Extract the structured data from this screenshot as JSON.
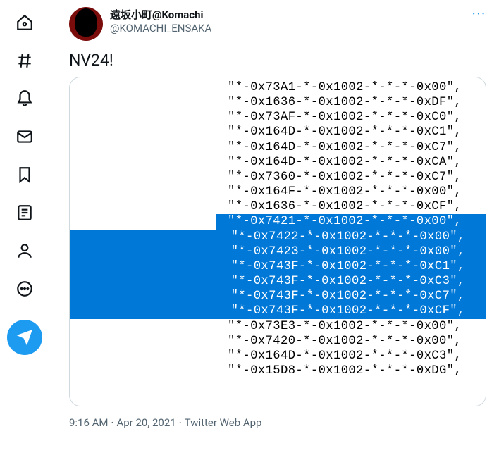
{
  "sidebar": {
    "items": [
      {
        "name": "home-icon"
      },
      {
        "name": "explore-icon"
      },
      {
        "name": "notifications-icon"
      },
      {
        "name": "messages-icon"
      },
      {
        "name": "bookmarks-icon"
      },
      {
        "name": "lists-icon"
      },
      {
        "name": "profile-icon"
      },
      {
        "name": "more-icon"
      }
    ]
  },
  "tweet": {
    "display_name": "遠坂小町@Komachi",
    "handle": "@KOMACHI_ENSAKA",
    "text": "NV24!",
    "more_label": "···",
    "timestamp": "9:16 AM",
    "date": "Apr 20, 2021",
    "source": "Twitter Web App"
  },
  "code": {
    "lines": [
      {
        "t": "\"*-0x73A1-*-0x1002-*-*-*-0x00\",",
        "hl": false
      },
      {
        "t": "\"*-0x1636-*-0x1002-*-*-*-0xDF\",",
        "hl": false
      },
      {
        "t": "\"*-0x73AF-*-0x1002-*-*-*-0xC0\",",
        "hl": false
      },
      {
        "t": "\"*-0x164D-*-0x1002-*-*-*-0xC1\",",
        "hl": false
      },
      {
        "t": "\"*-0x164D-*-0x1002-*-*-*-0xC7\",",
        "hl": false
      },
      {
        "t": "\"*-0x164D-*-0x1002-*-*-*-0xCA\",",
        "hl": false
      },
      {
        "t": "\"*-0x7360-*-0x1002-*-*-*-0xC7\",",
        "hl": false
      },
      {
        "t": "\"*-0x164F-*-0x1002-*-*-*-0x00\",",
        "hl": false
      },
      {
        "t": "\"*-0x1636-*-0x1002-*-*-*-0xCF\",",
        "hl": false
      },
      {
        "t": "\"*-0x7421-*-0x1002-*-*-*-0x00\",",
        "hl": true,
        "first": true
      },
      {
        "t": "            \"*-0x7422-*-0x1002-*-*-*-0x00\",",
        "hl": true
      },
      {
        "t": "            \"*-0x7423-*-0x1002-*-*-*-0x00\",",
        "hl": true
      },
      {
        "t": "            \"*-0x743F-*-0x1002-*-*-*-0xC1\",",
        "hl": true
      },
      {
        "t": "            \"*-0x743F-*-0x1002-*-*-*-0xC3\",",
        "hl": true
      },
      {
        "t": "            \"*-0x743F-*-0x1002-*-*-*-0xC7\",",
        "hl": true
      },
      {
        "t": "            \"*-0x743F-*-0x1002-*-*-*-0xCF\",",
        "hl": true
      },
      {
        "t": "\"*-0x73E3-*-0x1002-*-*-*-0x00\",",
        "hl": false
      },
      {
        "t": "\"*-0x7420-*-0x1002-*-*-*-0x00\",",
        "hl": false
      },
      {
        "t": "\"*-0x164D-*-0x1002-*-*-*-0xC3\",",
        "hl": false
      },
      {
        "t": "\"*-0x15D8-*-0x1002-*-*-*-0xDG\",",
        "hl": false
      }
    ]
  }
}
